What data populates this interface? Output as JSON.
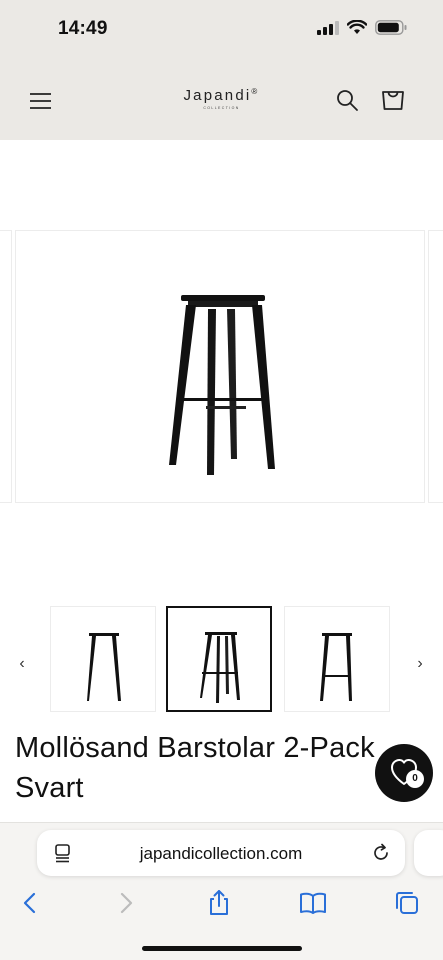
{
  "status_bar": {
    "time": "14:49"
  },
  "header": {
    "logo_text": "Japandi",
    "logo_mark": "®",
    "logo_subtitle": "COLLECTION",
    "menu_icon": "hamburger-icon",
    "search_icon": "search-icon",
    "cart_icon": "cart-icon"
  },
  "gallery": {
    "prev_icon": "chevron-left-icon",
    "next_icon": "chevron-right-icon",
    "prev_glyph": "‹",
    "next_glyph": "›",
    "thumbnails": [
      {
        "label": "thumbnail-1",
        "selected": false
      },
      {
        "label": "thumbnail-2",
        "selected": true
      },
      {
        "label": "thumbnail-3",
        "selected": false
      }
    ]
  },
  "product": {
    "title": "Mollösand Barstolar 2-Pack Svart"
  },
  "wishlist": {
    "count": "0",
    "icon": "heart-icon"
  },
  "browser": {
    "url": "japandicollection.com",
    "buttons": [
      "back-icon",
      "forward-icon",
      "share-icon",
      "bookmarks-icon",
      "tabs-icon"
    ]
  },
  "colors": {
    "header_bg": "#ebe9e5",
    "text": "#111111",
    "link_blue": "#2a6fd8"
  }
}
